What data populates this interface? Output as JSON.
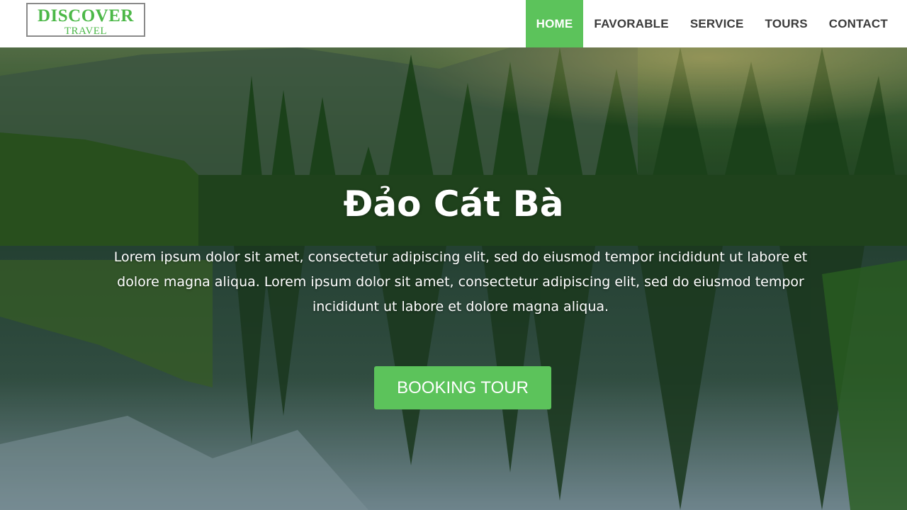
{
  "brand": {
    "name": "DISCOVER",
    "tagline": "TRAVEL",
    "accent_color": "#5cc35b"
  },
  "nav": {
    "items": [
      {
        "label": "HOME",
        "active": true
      },
      {
        "label": "FAVORABLE",
        "active": false
      },
      {
        "label": "SERVICE",
        "active": false
      },
      {
        "label": "TOURS",
        "active": false
      },
      {
        "label": "CONTACT",
        "active": false
      }
    ]
  },
  "hero": {
    "title": "Đảo Cát Bà",
    "description": "Lorem ipsum dolor sit amet, consectetur adipiscing elit, sed do eiusmod tempor incididunt ut labore et dolore magna aliqua. Lorem ipsum dolor sit amet, consectetur adipiscing elit, sed do eiusmod tempor incididunt ut labore et dolore magna aliqua.",
    "cta_label": "BOOKING TOUR"
  }
}
